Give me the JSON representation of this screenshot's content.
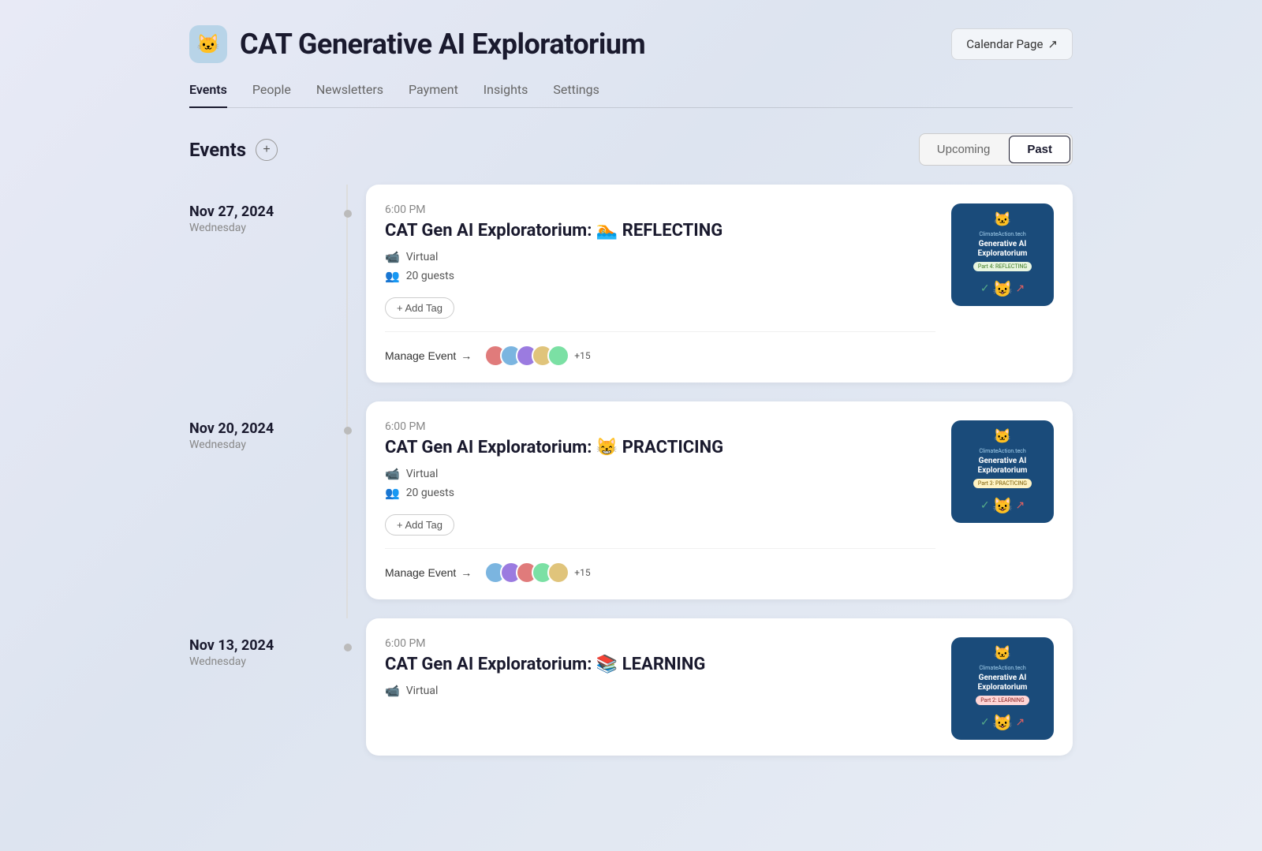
{
  "app": {
    "logo_emoji": "🐱",
    "title": "CAT Generative AI Exploratorium",
    "calendar_page_btn": "Calendar Page",
    "calendar_page_arrow": "↗"
  },
  "nav": {
    "items": [
      {
        "label": "Events",
        "active": true
      },
      {
        "label": "People",
        "active": false
      },
      {
        "label": "Newsletters",
        "active": false
      },
      {
        "label": "Payment",
        "active": false
      },
      {
        "label": "Insights",
        "active": false
      },
      {
        "label": "Settings",
        "active": false
      }
    ]
  },
  "events_section": {
    "title": "Events",
    "add_btn": "+",
    "toggle": {
      "upcoming": "Upcoming",
      "past": "Past",
      "active": "past"
    }
  },
  "events": [
    {
      "date": "Nov 27, 2024",
      "day": "Wednesday",
      "time": "6:00 PM",
      "name": "CAT Gen AI Exploratorium: 🏊 REFLECTING",
      "type": "Virtual",
      "guests": "20 guests",
      "add_tag": "+ Add Tag",
      "manage_event": "Manage Event",
      "avatar_count": "+15",
      "image": {
        "brand": "ClimateAction.tech",
        "title": "Generative AI Exploratorium",
        "badge": "Part 4: REFLECTING",
        "badge_class": "badge-reflecting",
        "cat_emoji": "🐱"
      }
    },
    {
      "date": "Nov 20, 2024",
      "day": "Wednesday",
      "time": "6:00 PM",
      "name": "CAT Gen AI Exploratorium: 😸 PRACTICING",
      "type": "Virtual",
      "guests": "20 guests",
      "add_tag": "+ Add Tag",
      "manage_event": "Manage Event",
      "avatar_count": "+15",
      "image": {
        "brand": "ClimateAction.tech",
        "title": "Generative AI Exploratorium",
        "badge": "Part 3: PRACTICING",
        "badge_class": "badge-practicing",
        "cat_emoji": "🐱"
      }
    },
    {
      "date": "Nov 13, 2024",
      "day": "Wednesday",
      "time": "6:00 PM",
      "name": "CAT Gen AI Exploratorium: 📚 LEARNING",
      "type": "Virtual",
      "guests": "",
      "add_tag": "",
      "manage_event": "",
      "avatar_count": "",
      "image": {
        "brand": "ClimateAction.tech",
        "title": "Generative AI Exploratorium",
        "badge": "Part 2: LEARNING",
        "badge_class": "badge-learning",
        "cat_emoji": "🐱"
      }
    }
  ],
  "colors": {
    "accent": "#1a1a2e",
    "card_bg": "#ffffff",
    "bg_gradient_start": "#e8eaf6",
    "bg_gradient_end": "#dde4f0"
  }
}
